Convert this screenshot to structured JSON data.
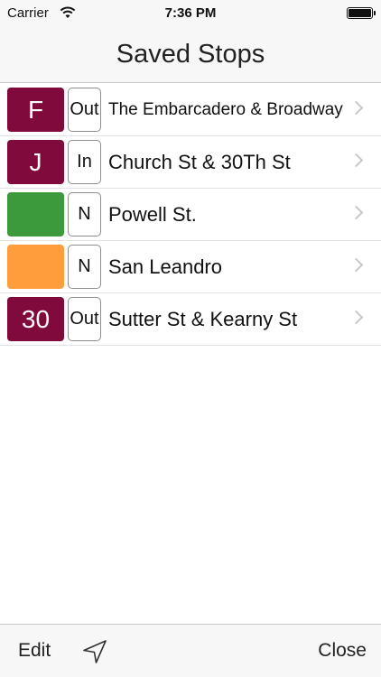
{
  "status_bar": {
    "carrier": "Carrier",
    "time": "7:36 PM"
  },
  "nav": {
    "title": "Saved Stops"
  },
  "stops": [
    {
      "route": "F",
      "route_color": "#800a3c",
      "direction": "Out",
      "stop": "The Embarcadero & Broadway"
    },
    {
      "route": "J",
      "route_color": "#800a3c",
      "direction": "In",
      "stop": "Church St & 30Th St"
    },
    {
      "route": "",
      "route_color": "#3c9a3c",
      "direction": "N",
      "stop": "Powell St."
    },
    {
      "route": "",
      "route_color": "#ff9d3c",
      "direction": "N",
      "stop": "San Leandro"
    },
    {
      "route": "30",
      "route_color": "#800a3c",
      "direction": "Out",
      "stop": "Sutter St & Kearny St"
    }
  ],
  "toolbar": {
    "edit_label": "Edit",
    "location_icon": "location-arrow-icon",
    "close_label": "Close"
  }
}
